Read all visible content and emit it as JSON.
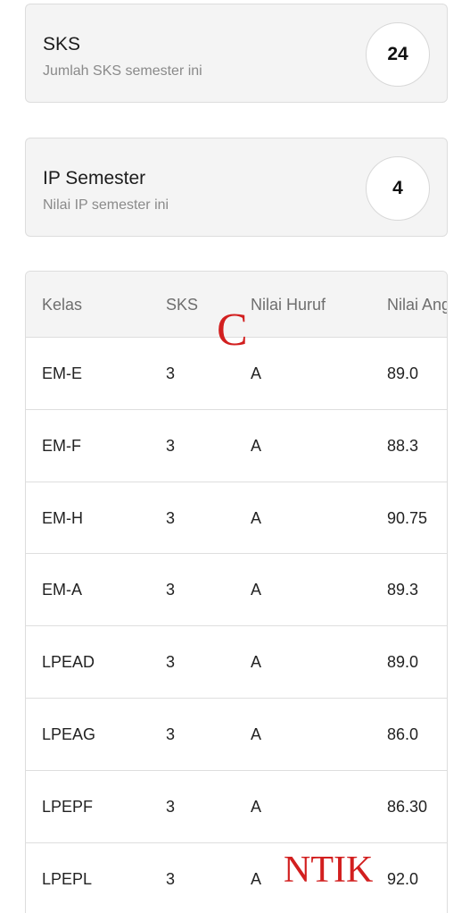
{
  "sks_card": {
    "title": "SKS",
    "subtitle": "Jumlah SKS semester ini",
    "value": "24"
  },
  "ip_card": {
    "title": "IP Semester",
    "subtitle": "Nilai IP semester ini",
    "value": "4"
  },
  "table": {
    "headers": [
      "Kelas",
      "SKS",
      "Nilai Huruf",
      "Nilai Angka"
    ],
    "rows": [
      [
        "EM-E",
        "3",
        "A",
        "89.0"
      ],
      [
        "EM-F",
        "3",
        "A",
        "88.3"
      ],
      [
        "EM-H",
        "3",
        "A",
        "90.75"
      ],
      [
        "EM-A",
        "3",
        "A",
        "89.3"
      ],
      [
        "LPEAD",
        "3",
        "A",
        "89.0"
      ],
      [
        "LPEAG",
        "3",
        "A",
        "86.0"
      ],
      [
        "LPEPF",
        "3",
        "A",
        "86.30"
      ],
      [
        "LPEPL",
        "3",
        "A",
        "92.0"
      ]
    ]
  },
  "overlays": {
    "mark_c": "C",
    "mark_ntik": "NTIK",
    "color": "#d21f1f"
  }
}
